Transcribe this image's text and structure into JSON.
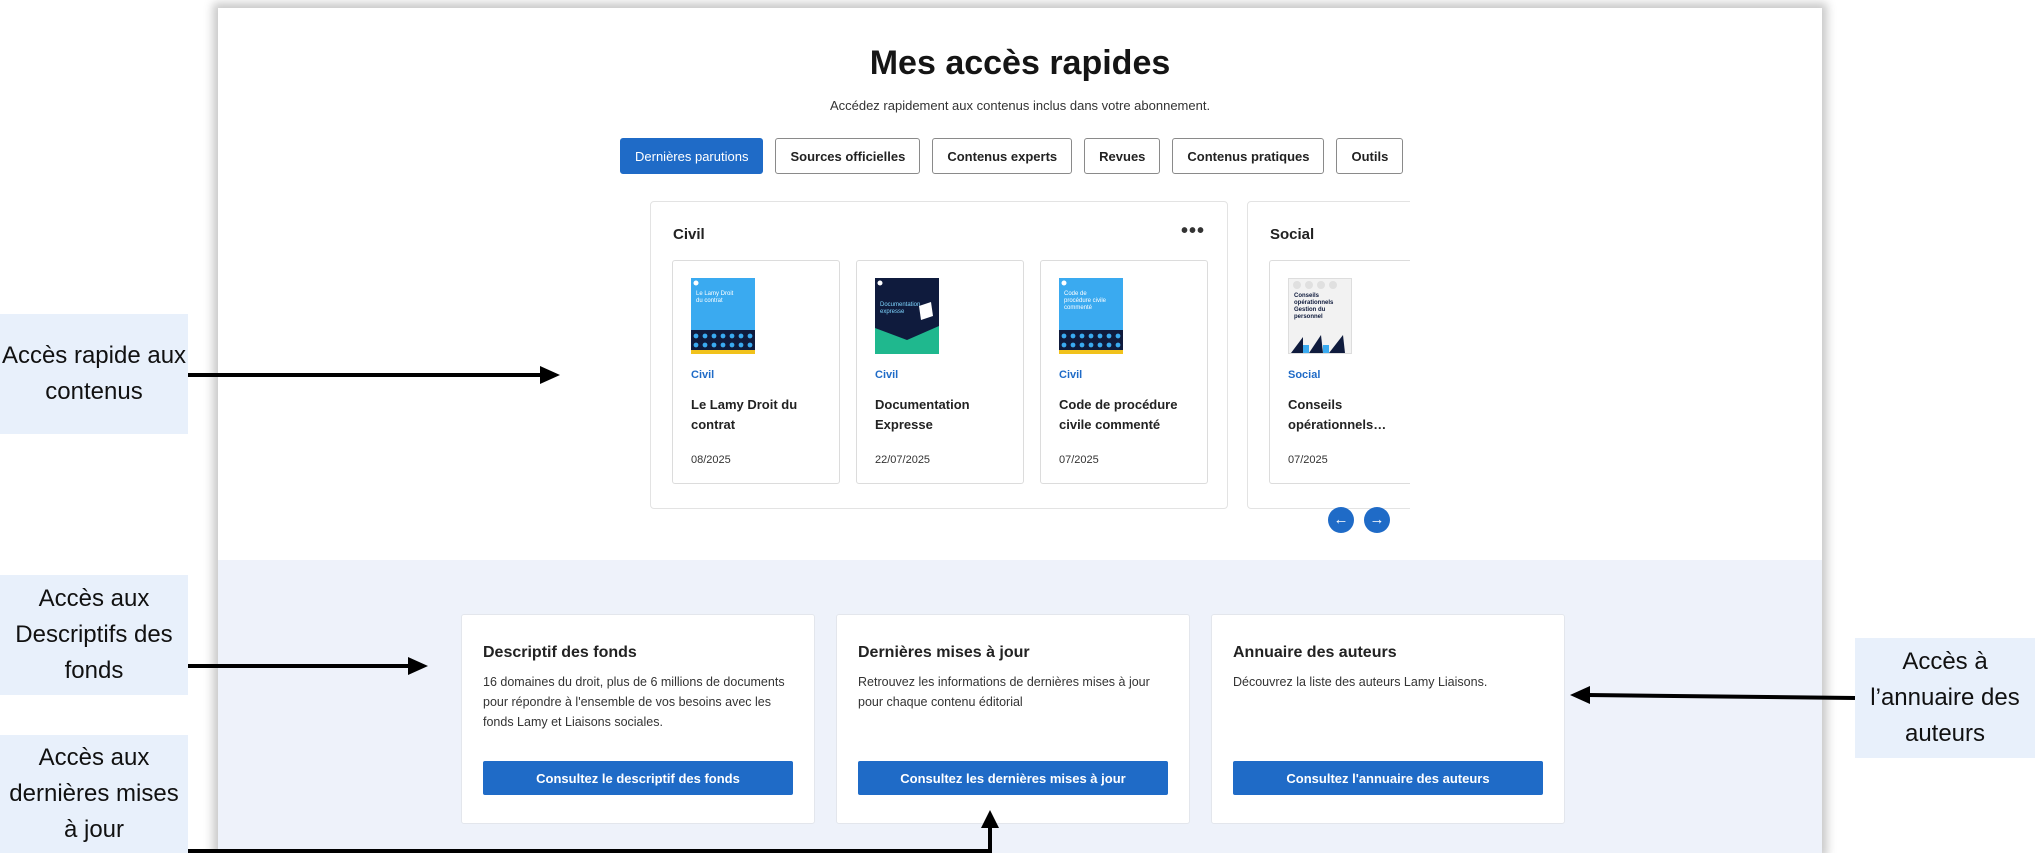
{
  "header": {
    "title": "Mes accès rapides",
    "subtitle": "Accédez rapidement aux contenus inclus dans votre abonnement."
  },
  "tabs": [
    {
      "label": "Dernières parutions",
      "active": true
    },
    {
      "label": "Sources officielles",
      "active": false
    },
    {
      "label": "Contenus experts",
      "active": false
    },
    {
      "label": "Revues",
      "active": false
    },
    {
      "label": "Contenus pratiques",
      "active": false
    },
    {
      "label": "Outils",
      "active": false
    }
  ],
  "carousel": {
    "groups": [
      {
        "title": "Civil",
        "more_icon": "more-horizontal-icon",
        "cards": [
          {
            "category": "Civil",
            "name": "Le Lamy Droit du contrat",
            "date": "08/2025",
            "cover_text": "Le Lamy Droit du contrat",
            "cover_color": "#3aaaf0"
          },
          {
            "category": "Civil",
            "name": "Documentation Expresse",
            "date": "22/07/2025",
            "cover_text": "Documentation expresse",
            "cover_color": "#0f1b3d"
          },
          {
            "category": "Civil",
            "name": "Code de procédure civile commenté",
            "date": "07/2025",
            "cover_text": "Code de procédure civile commenté",
            "cover_color": "#3aaaf0"
          }
        ]
      },
      {
        "title": "Social",
        "cards": [
          {
            "category": "Social",
            "name": "Conseils opérationnels…",
            "date": "07/2025",
            "cover_text": "Conseils opérationnels Gestion du personnel",
            "cover_color": "#f2f2f2"
          }
        ]
      }
    ],
    "prev_icon": "arrow-left-icon",
    "next_icon": "arrow-right-icon",
    "prev_glyph": "←",
    "next_glyph": "→"
  },
  "panels": [
    {
      "title": "Descriptif des fonds",
      "text": "16 domaines du droit, plus de 6 millions de documents pour répondre à l'ensemble de vos besoins avec les fonds Lamy et Liaisons sociales.",
      "button": "Consultez le descriptif des fonds"
    },
    {
      "title": "Dernières mises à jour",
      "text": "Retrouvez les informations de dernières mises à jour pour chaque contenu éditorial",
      "button": "Consultez les dernières mises à jour"
    },
    {
      "title": "Annuaire des auteurs",
      "text": "Découvrez la liste des auteurs Lamy Liaisons.",
      "button": "Consultez l'annuaire des auteurs"
    }
  ],
  "callouts": {
    "quick_access": "Accès rapide aux contenus",
    "descriptifs": "Accès aux Descriptifs des fonds",
    "updates": "Accès aux dernières mises à jour",
    "authors": "Accès à l’annuaire des auteurs"
  },
  "colors": {
    "accent": "#1f6bc7",
    "callout_bg": "#e8f0fb",
    "bottom_bg": "#eef2fa"
  }
}
